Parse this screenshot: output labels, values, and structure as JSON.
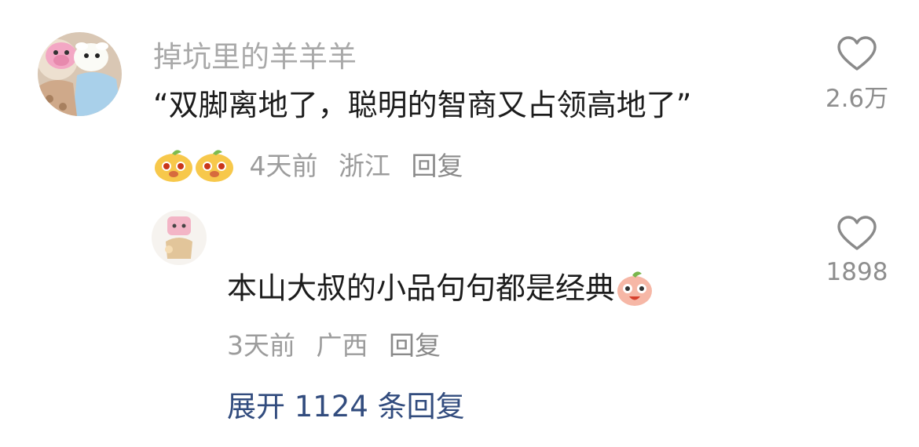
{
  "comment": {
    "username": "掉坑里的羊羊羊",
    "text": "“双脚离地了，聪明的智商又占领高地了”",
    "time": "4天前",
    "location": "浙江",
    "reply_label": "回复",
    "likes": "2.6万"
  },
  "reply": {
    "text": "本山大叔的小品句句都是经典",
    "time": "3天前",
    "location": "广西",
    "reply_label": "回复",
    "likes": "1898"
  },
  "expand_label": "展开 1124 条回复",
  "colors": {
    "username": "#a9a9a9",
    "body_text": "#1c1c1c",
    "meta_text": "#9c9c9c",
    "link": "#324c7e",
    "icon_stroke": "#8a8a8a"
  }
}
